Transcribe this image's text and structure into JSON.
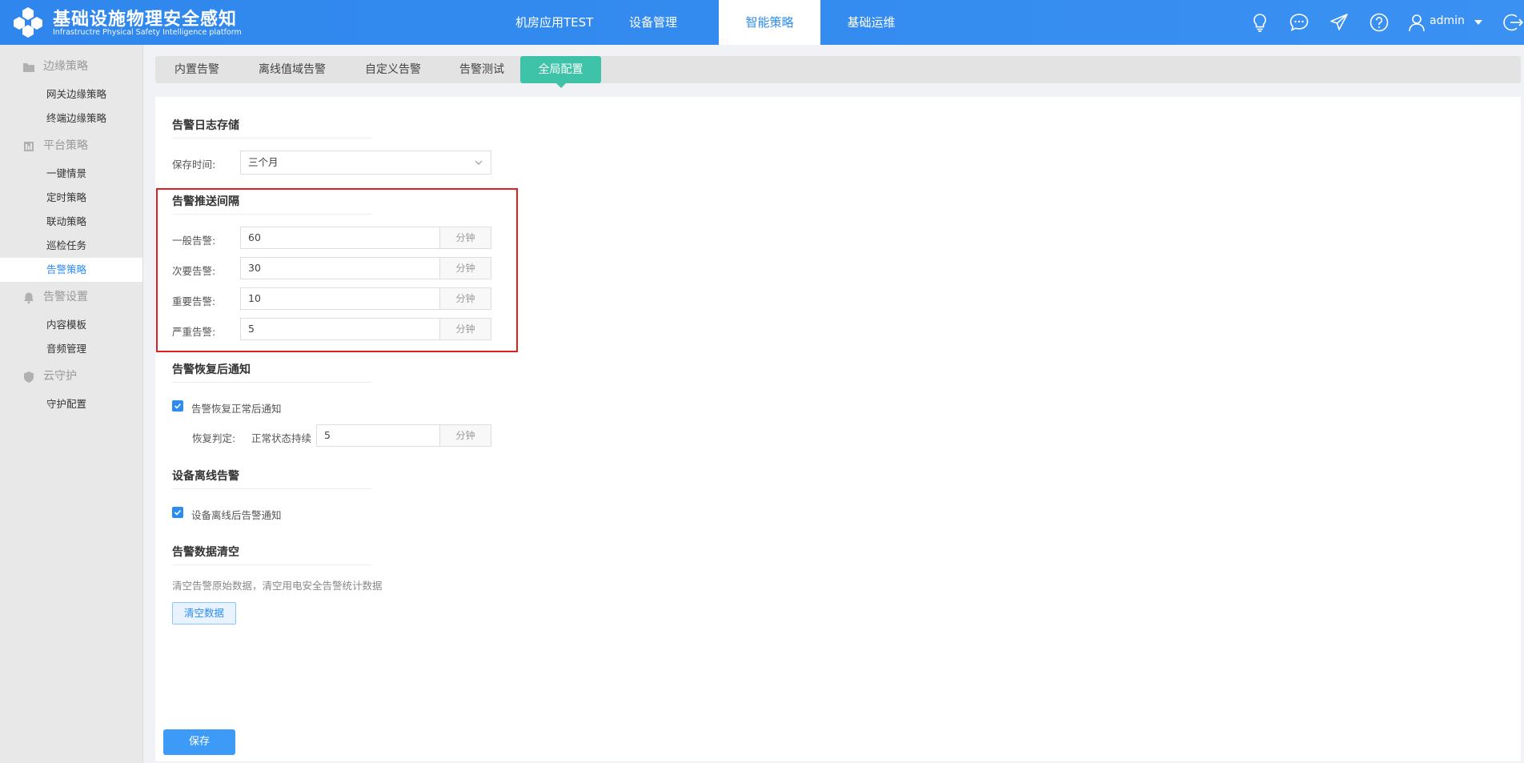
{
  "header": {
    "title": "基础设施物理安全感知",
    "subtitle": "Infrastructre Physical Safety Intelligence platform",
    "logo_icon": "hexagon-cluster-logo",
    "nav": [
      {
        "label": "机房应用TEST",
        "active": false
      },
      {
        "label": "设备管理",
        "active": false
      },
      {
        "label": "智能策略",
        "active": true
      },
      {
        "label": "基础运维",
        "active": false
      }
    ],
    "icons": [
      "lightbulb-icon",
      "chat-bubble-icon",
      "paper-plane-icon",
      "help-circle-icon",
      "user-icon",
      "caret-down-icon",
      "logout-icon"
    ],
    "user": "admin"
  },
  "sidebar": {
    "groups": [
      {
        "label": "边缘策略",
        "icon": "folder-icon",
        "items": [
          "网关边缘策略",
          "终端边缘策略"
        ]
      },
      {
        "label": "平台策略",
        "icon": "policy-icon",
        "items": [
          "一键情景",
          "定时策略",
          "联动策略",
          "巡检任务",
          "告警策略"
        ]
      },
      {
        "label": "告警设置",
        "icon": "bell-gear-icon",
        "items": [
          "内容模板",
          "音频管理"
        ]
      },
      {
        "label": "云守护",
        "icon": "shield-icon",
        "items": [
          "守护配置"
        ]
      }
    ],
    "active_item": "告警策略"
  },
  "tabs": [
    {
      "label": "内置告警",
      "active": false
    },
    {
      "label": "离线值域告警",
      "active": false
    },
    {
      "label": "自定义告警",
      "active": false
    },
    {
      "label": "告警测试",
      "active": false
    },
    {
      "label": "全局配置",
      "active": true
    }
  ],
  "log_storage": {
    "title": "告警日志存储",
    "retention_label": "保存时间:",
    "retention_value": "三个月"
  },
  "push_interval": {
    "title": "告警推送间隔",
    "rows": [
      {
        "label": "一般告警:",
        "value": "60",
        "unit": "分钟"
      },
      {
        "label": "次要告警:",
        "value": "30",
        "unit": "分钟"
      },
      {
        "label": "重要告警:",
        "value": "10",
        "unit": "分钟"
      },
      {
        "label": "严重告警:",
        "value": "5",
        "unit": "分钟"
      }
    ]
  },
  "recovery_notify": {
    "title": "告警恢复后通知",
    "checkbox_label": "告警恢复正常后通知",
    "checked": true,
    "judge_label": "恢复判定:",
    "duration_label": "正常状态持续",
    "duration_value": "5",
    "unit": "分钟"
  },
  "offline_alarm": {
    "title": "设备离线告警",
    "checkbox_label": "设备离线后告警通知",
    "checked": true
  },
  "data_clear": {
    "title": "告警数据清空",
    "description": "清空告警原始数据，清空用电安全告警统计数据",
    "button_label": "清空数据"
  },
  "save_label": "保存",
  "colors": {
    "header_blue": "#2d8cf0",
    "tab_active_green": "#3fc3a8",
    "highlight_red": "#e02020",
    "checkbox_blue": "#2d8cf0"
  }
}
